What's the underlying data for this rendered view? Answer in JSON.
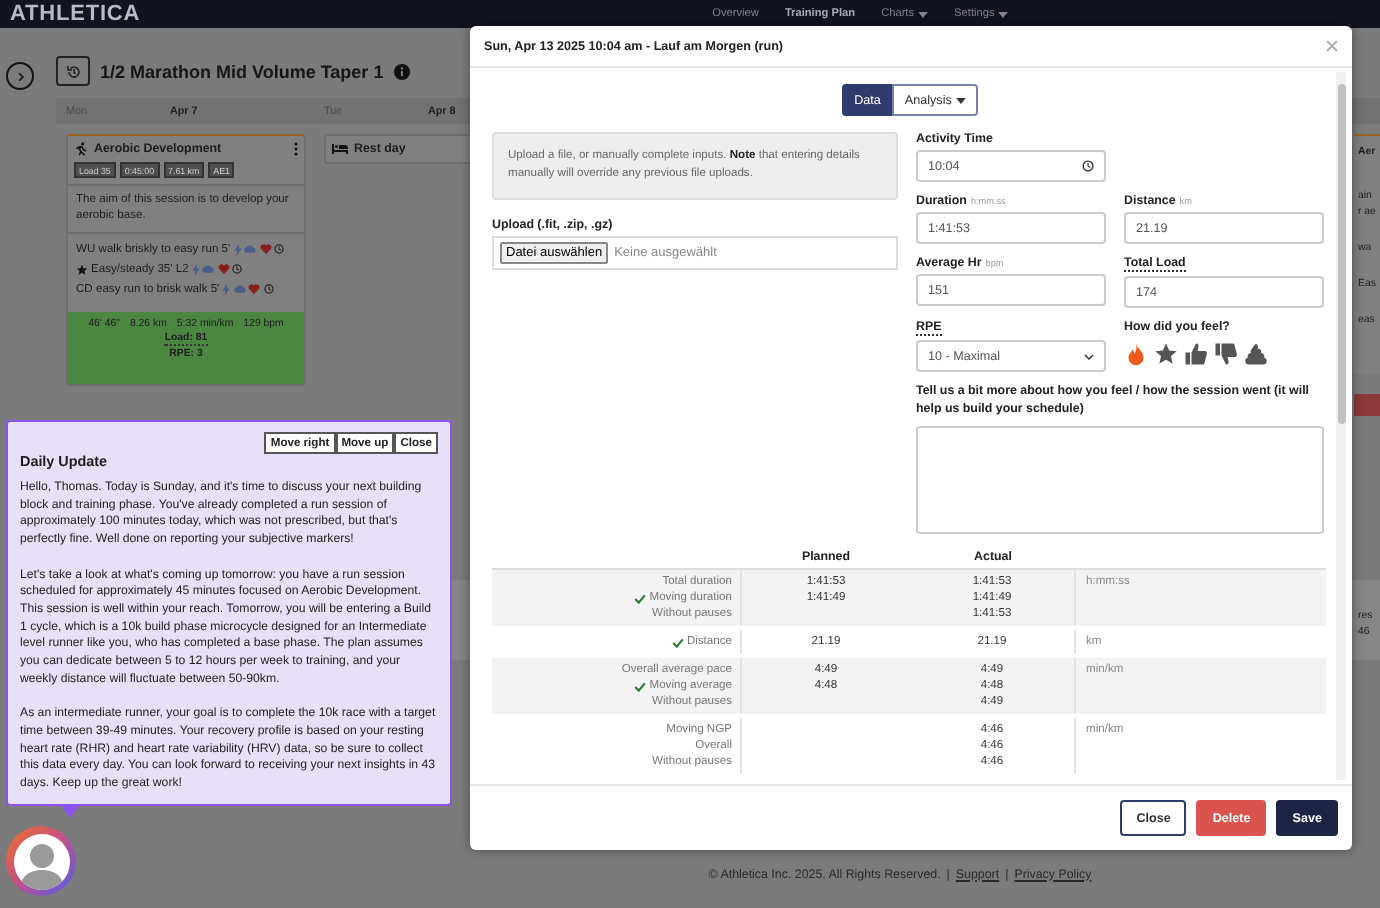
{
  "navbar": {
    "logo": "ATHLETICA",
    "links": [
      {
        "label": "Overview",
        "selected": false,
        "dropdown": false
      },
      {
        "label": "Training Plan",
        "selected": true,
        "dropdown": false
      },
      {
        "label": "Charts",
        "selected": false,
        "dropdown": true
      },
      {
        "label": "Settings",
        "selected": false,
        "dropdown": true
      }
    ]
  },
  "plan": {
    "title": "1/2 Marathon Mid Volume Taper 1",
    "days": [
      {
        "weekday": "Mon",
        "date": "Apr 7",
        "session": {
          "kind": "workout",
          "title": "Aerobic Development",
          "badges": [
            "Load 35",
            "0:45:00",
            "7.61 km",
            "AE1"
          ],
          "description": "The aim of this session is to develop your aerobic base.",
          "steps": [
            {
              "text": "WU walk briskly to easy run 5'",
              "starred": false
            },
            {
              "text": "Easy/steady 35' L2",
              "starred": true
            },
            {
              "text": "CD easy run to brisk walk 5'",
              "starred": false
            }
          ],
          "result": {
            "stats": [
              "46' 46\"",
              "8.26 km",
              "5:32 min/km",
              "129 bpm"
            ],
            "load": "Load: 81",
            "rpe": "RPE: 3"
          }
        }
      },
      {
        "weekday": "Tue",
        "date": "Apr 8",
        "session": {
          "kind": "rest",
          "title": "Rest day"
        }
      }
    ],
    "edge_card": {
      "title": "Aer",
      "description": [
        "ain",
        "r ae"
      ],
      "steps": [
        "wa",
        "Eas",
        "eas"
      ]
    },
    "next_week_edge": [
      "res",
      "46"
    ]
  },
  "modal": {
    "title": "Sun, Apr 13 2025 10:04 am - Lauf am Morgen (run)",
    "view_tabs": [
      {
        "label": "Data",
        "selected": true,
        "dropdown": false
      },
      {
        "label": "Analysis",
        "selected": false,
        "dropdown": true
      }
    ],
    "notice": "Upload a file, or manually complete inputs. **Note** that entering details manually will override any previous file uploads.",
    "upload": {
      "label": "Upload (.fit, .zip, .gz)",
      "button": "Datei auswählen",
      "status": "Keine ausgewählt"
    },
    "fields": [
      {
        "kind": "time",
        "label": "Activity Time",
        "value": "10:04",
        "tooltip": false
      },
      {
        "kind": "text",
        "label": "Duration",
        "unit": "h:mm:ss",
        "value": "1:41:53",
        "tooltip": false
      },
      {
        "kind": "text",
        "label": "Distance",
        "unit": "km",
        "value": "21.19",
        "tooltip": false
      },
      {
        "kind": "text",
        "label": "Average Hr",
        "unit": "bpm",
        "value": "151",
        "tooltip": false
      },
      {
        "kind": "text",
        "label": "Total Load",
        "value": "174",
        "tooltip": true
      },
      {
        "kind": "select",
        "label": "RPE",
        "value": "10 - Maximal",
        "tooltip": true
      }
    ],
    "feel": {
      "label": "How did you feel?",
      "options": [
        {
          "kind": "flame",
          "selected": true
        },
        {
          "kind": "star",
          "selected": false
        },
        {
          "kind": "thumbs-up",
          "selected": false
        },
        {
          "kind": "thumbs-down",
          "selected": false
        },
        {
          "kind": "poop",
          "selected": false
        }
      ]
    },
    "comment": {
      "label": "Tell us a bit more about how you feel / how the session went (it will help us build your schedule)"
    },
    "comparison": {
      "columns": [
        "Planned",
        "Actual"
      ],
      "groups": [
        {
          "labels": [
            {
              "text": "Total duration",
              "checked": false
            },
            {
              "text": "Moving duration",
              "checked": true
            },
            {
              "text": "Without pauses",
              "checked": false
            }
          ],
          "planned": [
            "1:41:53",
            "1:41:49"
          ],
          "actual": [
            "1:41:53",
            "1:41:49",
            "1:41:53"
          ],
          "unit": "h:mm:ss"
        },
        {
          "labels": [
            {
              "text": "Distance",
              "checked": true
            }
          ],
          "planned": [
            "21.19"
          ],
          "actual": [
            "21.19"
          ],
          "unit": "km"
        },
        {
          "labels": [
            {
              "text": "Overall average pace",
              "checked": false
            },
            {
              "text": "Moving average",
              "checked": true
            },
            {
              "text": "Without pauses",
              "checked": false
            }
          ],
          "planned": [
            "4:49",
            "4:48"
          ],
          "actual": [
            "4:49",
            "4:48",
            "4:49"
          ],
          "unit": "min/km"
        },
        {
          "labels": [
            {
              "text": "Moving NGP",
              "checked": false
            },
            {
              "text": "Overall",
              "checked": false
            },
            {
              "text": "Without pauses",
              "checked": false
            }
          ],
          "actual": [
            "4:46",
            "4:46",
            "4:46"
          ],
          "unit": "min/km"
        }
      ]
    },
    "buttons": [
      {
        "kind": "outline",
        "label": "Close"
      },
      {
        "kind": "danger",
        "label": "Delete"
      },
      {
        "kind": "primary",
        "label": "Save"
      }
    ]
  },
  "daily_update": {
    "buttons": [
      "Move right",
      "Move up",
      "Close"
    ],
    "title": "Daily Update",
    "paragraphs": [
      "Hello, Thomas. Today is Sunday, and it's time to discuss your next building block and training phase. You've already completed a run session of approximately 100 minutes today, which was not prescribed, but that's perfectly fine. Well done on reporting your subjective markers!",
      "Let's take a look at what's coming up tomorrow: you have a run session scheduled for approximately 45 minutes focused on Aerobic Development. This session is well within your reach. Tomorrow, you will be entering a Build 1 cycle, which is a 10k build phase microcycle designed for an Intermediate level runner like you, who has completed a base phase. The plan assumes you can dedicate between 5 to 12 hours per week to training, and your weekly distance will fluctuate between 50-90km.",
      "As an intermediate runner, your goal is to complete the 10k race with a target time between 39-49 minutes. Your recovery profile is based on your resting heart rate (RHR) and heart rate variability (HRV) data, so be sure to collect this data every day. You can look forward to receiving your next insights in 43 days. Keep up the great work!"
    ]
  },
  "footer": [
    {
      "kind": "text",
      "text": "© Athletica Inc. 2025. All Rights Reserved."
    },
    {
      "kind": "separator",
      "text": "|"
    },
    {
      "kind": "link",
      "text": "Support"
    },
    {
      "kind": "separator",
      "text": "|"
    },
    {
      "kind": "link",
      "text": "Privacy Policy"
    }
  ]
}
